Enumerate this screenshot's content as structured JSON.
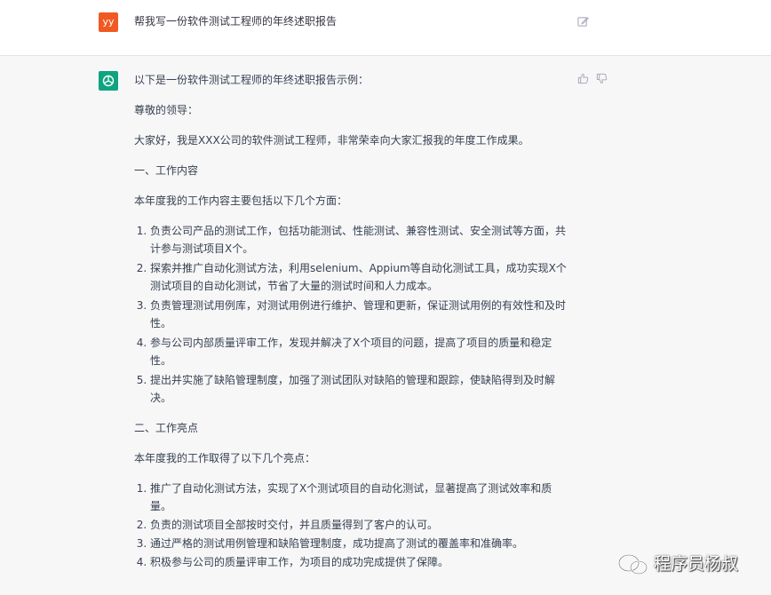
{
  "user_message": {
    "avatar_text": "yy",
    "text": "帮我写一份软件测试工程师的年终述职报告",
    "edit_icon": "edit-icon"
  },
  "assistant_message": {
    "avatar_icon": "openai-logo-icon",
    "intro": "以下是一份软件测试工程师的年终述职报告示例：",
    "greeting": "尊敬的领导：",
    "opening": "大家好，我是XXX公司的软件测试工程师，非常荣幸向大家汇报我的年度工作成果。",
    "section1_title": "一、工作内容",
    "section1_intro": "本年度我的工作内容主要包括以下几个方面：",
    "section1_items": [
      "负责公司产品的测试工作，包括功能测试、性能测试、兼容性测试、安全测试等方面，共计参与测试项目X个。",
      "探索并推广自动化测试方法，利用selenium、Appium等自动化测试工具，成功实现X个测试项目的自动化测试，节省了大量的测试时间和人力成本。",
      "负责管理测试用例库，对测试用例进行维护、管理和更新，保证测试用例的有效性和及时性。",
      "参与公司内部质量评审工作，发现并解决了X个项目的问题，提高了项目的质量和稳定性。",
      "提出并实施了缺陷管理制度，加强了测试团队对缺陷的管理和跟踪，使缺陷得到及时解决。"
    ],
    "section2_title": "二、工作亮点",
    "section2_intro": "本年度我的工作取得了以下几个亮点：",
    "section2_items": [
      "推广了自动化测试方法，实现了X个测试项目的自动化测试，显著提高了测试效率和质量。",
      "负责的测试项目全部按时交付，并且质量得到了客户的认可。",
      "通过严格的测试用例管理和缺陷管理制度，成功提高了测试的覆盖率和准确率。",
      "积极参与公司的质量评审工作，为项目的成功完成提供了保障。"
    ]
  },
  "watermark": {
    "icon": "wechat-icon",
    "text": "程序员杨叔"
  }
}
